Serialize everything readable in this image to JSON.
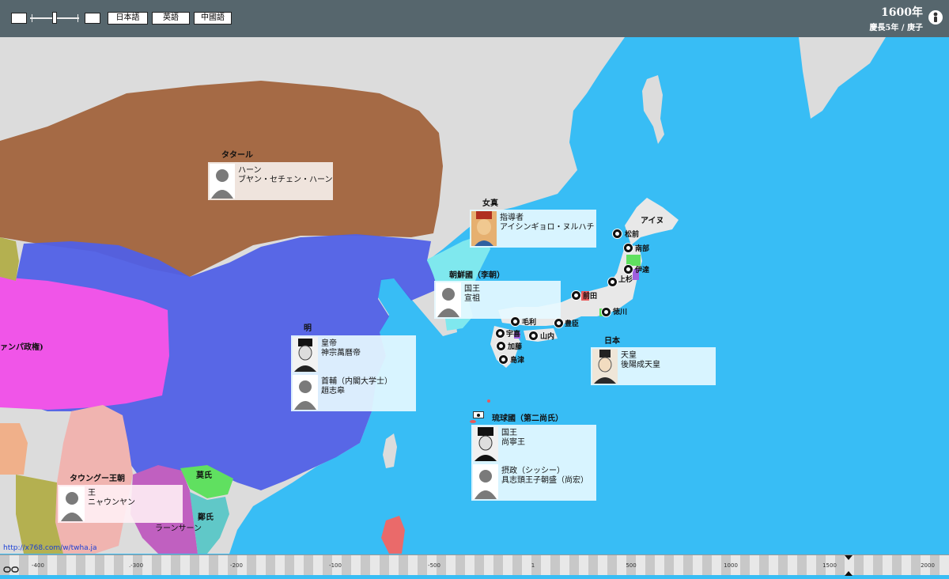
{
  "header": {
    "languages": [
      "日本語",
      "英語",
      "中國語"
    ],
    "year": "1600年",
    "era": "慶長5年 / 庚子"
  },
  "map_labels": {
    "tartar": "タタール",
    "jurchen": "女真",
    "ainu": "アイヌ",
    "joseon": "朝鮮國（李朝）",
    "ming": "明",
    "japan": "日本",
    "ryukyu": "琉球國（第二尚氏）",
    "toungoo": "タウングー王朝",
    "mac": "莫氏",
    "trinh": "鄭氏",
    "lanxang": "ラーンサーン",
    "champa": "ァンパ政権)"
  },
  "cards": {
    "tartar": {
      "title": "ハーン",
      "name": "ブヤン・セチェン・ハーン"
    },
    "jurchen": {
      "title": "指導者",
      "name": "アイシンギョロ・ヌルハチ"
    },
    "joseon": {
      "title": "国王",
      "name": "宣祖"
    },
    "ming_emperor": {
      "title": "皇帝",
      "name": "神宗萬曆帝"
    },
    "ming_minister": {
      "title": "首輔（内閣大学士）",
      "name": "趙志皋"
    },
    "japan": {
      "title": "天皇",
      "name": "後陽成天皇"
    },
    "ryukyu_king": {
      "title": "国王",
      "name": "尚寧王"
    },
    "ryukyu_regent": {
      "title": "摂政（シッシー）",
      "name": "具志頭王子朝盛（尚宏）"
    },
    "toungoo": {
      "title": "王",
      "name": "ニャウンヤン"
    }
  },
  "clans": {
    "matsumae": "松前",
    "nanbu": "南部",
    "date": "伊達",
    "uesugi": "上杉",
    "maeda": "前田",
    "tokugawa": "徳川",
    "mori": "毛利",
    "toyotomi": "豊臣",
    "ukita": "宇喜",
    "yamauchi": "山内",
    "kato": "加藤",
    "shimazu": "島津"
  },
  "footer": {
    "link": "http://x768.com/w/twha.ja"
  },
  "timeline": {
    "ticks": [
      "-400",
      ".-300",
      "-200",
      "-100",
      "-500",
      "1",
      "500",
      "1000",
      "1500",
      "2000"
    ],
    "marker_year": "1600"
  },
  "colors": {
    "sea": "#38bdf5",
    "tartar": "#a56a45",
    "ming": "#5060e6",
    "joseon": "#7fe8ee",
    "champa": "#f055e8",
    "toungoo": "#f0b4b0",
    "mac": "#60e060",
    "trinh": "#60c8c8",
    "lanxang": "#c060c0",
    "japan_land": "#f0f0f0"
  },
  "icons": [
    "zoom-out-icon",
    "zoom-in-icon",
    "person-icon",
    "link-icon",
    "timeline-marker-icon"
  ]
}
